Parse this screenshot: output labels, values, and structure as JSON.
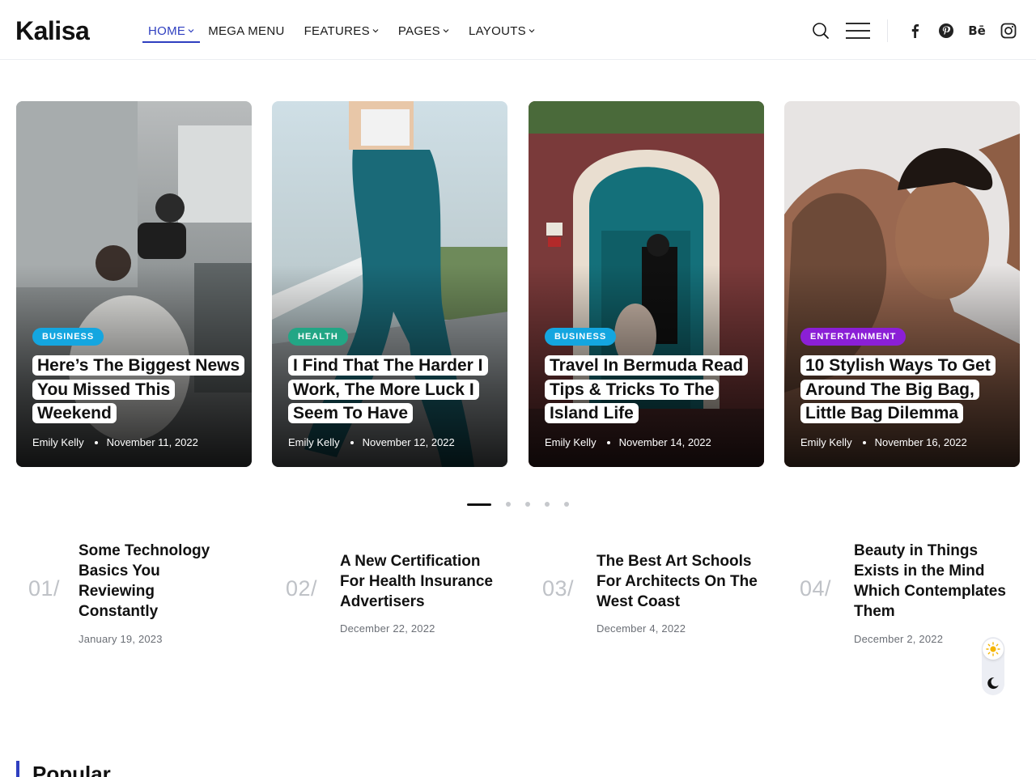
{
  "brand": "Kalisa",
  "nav": {
    "home": "HOME",
    "mega": "MEGA MENU",
    "features": "FEATURES",
    "pages": "PAGES",
    "layouts": "LAYOUTS"
  },
  "header_icons": [
    "search-icon",
    "hamburger-menu-icon",
    "facebook-icon",
    "pinterest-icon",
    "behance-icon",
    "instagram-icon"
  ],
  "behance_glyph": "Bē",
  "accent_color": "#2f3fc0",
  "cards": [
    {
      "category": "BUSINESS",
      "category_color": "#14a6e0",
      "title": "Here’s The Biggest News You Missed This Weekend",
      "author": "Emily Kelly",
      "date": "November 11, 2022"
    },
    {
      "category": "HEALTH",
      "category_color": "#22a685",
      "title": "I Find That The Harder I Work, The More Luck I Seem To Have",
      "author": "Emily Kelly",
      "date": "November 12, 2022"
    },
    {
      "category": "BUSINESS",
      "category_color": "#14a6e0",
      "title": "Travel In Bermuda Read Tips & Tricks To The Island Life",
      "author": "Emily Kelly",
      "date": "November 14, 2022"
    },
    {
      "category": "ENTERTAINMENT",
      "category_color": "#8b1fd6",
      "title": "10 Stylish Ways To Get Around The Big Bag, Little Bag Dilemma",
      "author": "Emily Kelly",
      "date": "November 16, 2022"
    }
  ],
  "slider": {
    "pages": 5,
    "active": 1
  },
  "trending": [
    {
      "num": "01/",
      "title": "Some Technology Basics You Reviewing Constantly",
      "date": "January 19, 2023"
    },
    {
      "num": "02/",
      "title": "A New Certification For Health Insurance Advertisers",
      "date": "December 22, 2022"
    },
    {
      "num": "03/",
      "title": "The Best Art Schools For Architects On The West Coast",
      "date": "December 4, 2022"
    },
    {
      "num": "04/",
      "title": "Beauty in Things Exists in the Mind Which Contemplates Them",
      "date": "December 2, 2022"
    }
  ],
  "section_popular": "Popular"
}
